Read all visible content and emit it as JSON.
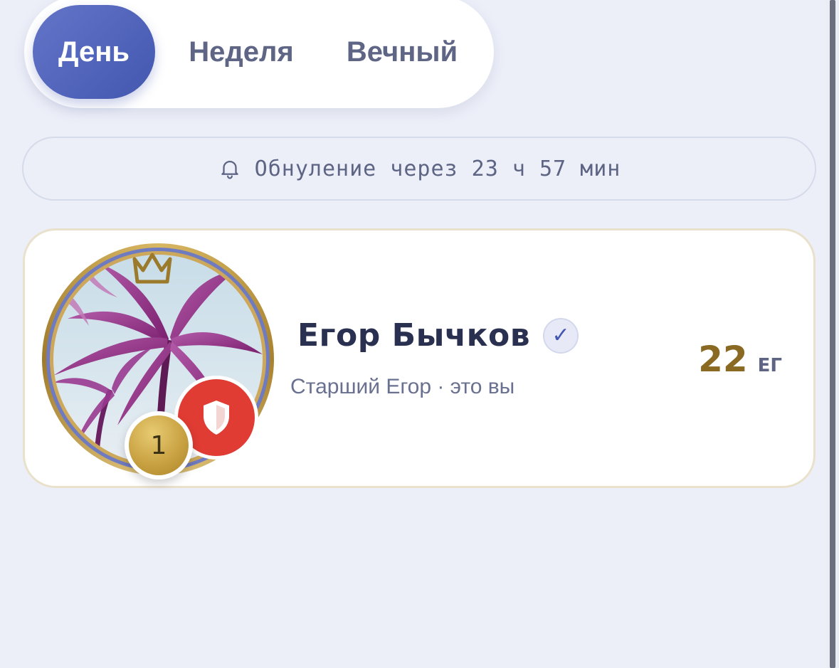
{
  "tabs": [
    {
      "label": "День",
      "active": true
    },
    {
      "label": "Неделя",
      "active": false
    },
    {
      "label": "Вечный",
      "active": false
    }
  ],
  "reset_banner": {
    "icon": "bell-icon",
    "text": "Обнуление через 23 ч 57 мин"
  },
  "leader": {
    "rank": "1",
    "name": "Егор Бычков",
    "verified": true,
    "subtitle": "Старший Егор · это вы",
    "score": "22",
    "score_unit": "ЕГ",
    "avatar_icon": "palm-trees-photo",
    "crown_icon": "crown-icon",
    "badge_icon": "shield-icon"
  },
  "colors": {
    "accent": "#4357b0",
    "background": "#eceff8",
    "gold": "#8a6a23",
    "badge_red": "#e03c33"
  }
}
